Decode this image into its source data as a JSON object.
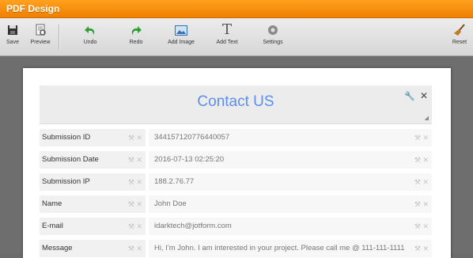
{
  "window": {
    "title": "PDF Design"
  },
  "toolbar": {
    "save": "Save",
    "preview": "Preview",
    "undo": "Undo",
    "redo": "Redo",
    "add_image": "Add Image",
    "add_text": "Add Text",
    "settings": "Settings",
    "reset": "Reset",
    "add_text_glyph": "T"
  },
  "document": {
    "heading": "Contact US",
    "fields": [
      {
        "label": "Submission ID",
        "value": "344157120776440057"
      },
      {
        "label": "Submission Date",
        "value": "2016-07-13 02:25:20"
      },
      {
        "label": "Submission IP",
        "value": "188.2.76.77"
      },
      {
        "label": "Name",
        "value": "John Doe"
      },
      {
        "label": "E-mail",
        "value": "idarktech@jotform.com"
      },
      {
        "label": "Message",
        "value": "Hi, I'm John. I am interested in your project. Please call me @ 111-111-1111"
      }
    ]
  },
  "colors": {
    "titlebar": "#f58a06",
    "heading": "#5b8ff0",
    "canvas": "#6e6e6e"
  }
}
